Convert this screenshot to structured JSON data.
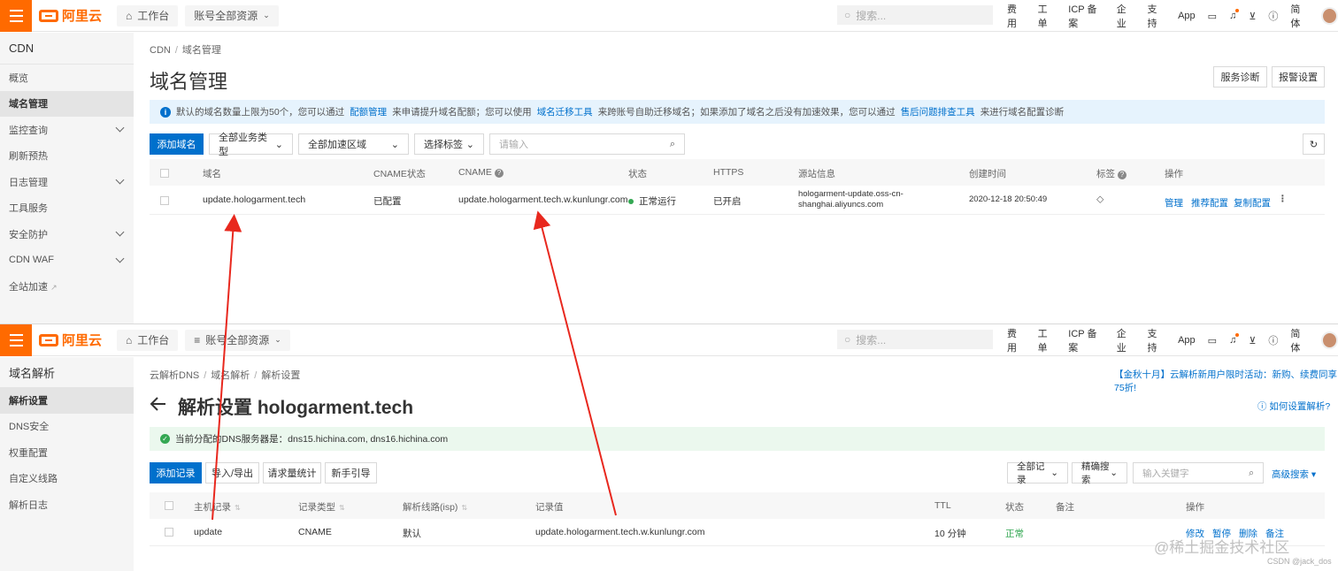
{
  "top": {
    "topbar": {
      "brand": "阿里云",
      "workbench": "工作台",
      "account_resources": "账号全部资源",
      "search_placeholder": "搜索...",
      "right_items": [
        "费用",
        "工单",
        "ICP 备案",
        "企业",
        "支持",
        "App"
      ],
      "lang": "简体"
    },
    "sidebar": {
      "title": "CDN",
      "items": [
        {
          "label": "概览",
          "expand": false,
          "active": false
        },
        {
          "label": "域名管理",
          "expand": false,
          "active": true
        },
        {
          "label": "监控查询",
          "expand": true,
          "active": false
        },
        {
          "label": "刷新预热",
          "expand": false,
          "active": false
        },
        {
          "label": "日志管理",
          "expand": true,
          "active": false
        },
        {
          "label": "工具服务",
          "expand": false,
          "active": false
        },
        {
          "label": "安全防护",
          "expand": true,
          "active": false
        },
        {
          "label": "CDN WAF",
          "expand": true,
          "active": false
        },
        {
          "label": "全站加速",
          "expand": false,
          "active": false,
          "external": true
        }
      ]
    },
    "breadcrumb": [
      "CDN",
      "域名管理"
    ],
    "page_title": "域名管理",
    "header_buttons": {
      "diagnose": "服务诊断",
      "alarm": "报警设置"
    },
    "notice": {
      "t1": "默认的域名数量上限为50个，您可以通过",
      "l1": "配额管理",
      "t2": "来申请提升域名配额；您可以使用",
      "l2": "域名迁移工具",
      "t3": "来跨账号自助迁移域名；如果添加了域名之后没有加速效果，您可以通过",
      "l3": "售后问题排查工具",
      "t4": "来进行域名配置诊断"
    },
    "toolbar": {
      "add_domain": "添加域名",
      "business_type": "全部业务类型",
      "region": "全部加速区域",
      "tags": "选择标签",
      "search_placeholder": "请输入"
    },
    "table": {
      "headers": {
        "domain": "域名",
        "cname_status": "CNAME状态",
        "cname": "CNAME",
        "status": "状态",
        "https": "HTTPS",
        "origin": "源站信息",
        "created": "创建时间",
        "tags": "标签",
        "actions": "操作"
      },
      "rows": [
        {
          "domain": "update.hologarment.tech",
          "cname_status": "已配置",
          "cname": "update.hologarment.tech.w.kunlungr.com",
          "status": "正常运行",
          "https": "已开启",
          "origin_line1": "hologarment-update.oss-cn-",
          "origin_line2": "shanghai.aliyuncs.com",
          "created": "2020-12-18 20:50:49",
          "actions": [
            "管理",
            "推荐配置",
            "复制配置"
          ]
        }
      ]
    }
  },
  "bottom": {
    "topbar": {
      "brand": "阿里云",
      "workbench": "工作台",
      "account_resources": "账号全部资源",
      "search_placeholder": "搜索...",
      "right_items": [
        "费用",
        "工单",
        "ICP 备案",
        "企业",
        "支持",
        "App"
      ],
      "lang": "简体"
    },
    "sidebar": {
      "title": "域名解析",
      "items": [
        {
          "label": "解析设置",
          "active": true
        },
        {
          "label": "DNS安全",
          "active": false
        },
        {
          "label": "权重配置",
          "active": false
        },
        {
          "label": "自定义线路",
          "active": false
        },
        {
          "label": "解析日志",
          "active": false
        }
      ]
    },
    "breadcrumb": [
      "云解析DNS",
      "域名解析",
      "解析设置"
    ],
    "promo": "【金秋十月】云解析新用户限时活动：新购、续费同享75折!",
    "page_title": "解析设置 hologarment.tech",
    "help_link": "如何设置解析?",
    "dns_notice": "当前分配的DNS服务器是：dns15.hichina.com, dns16.hichina.com",
    "toolbar": {
      "add_record": "添加记录",
      "import_export": "导入/导出",
      "request_stats": "请求量统计",
      "guide": "新手引导",
      "all_records": "全部记录",
      "precise_search": "精确搜索",
      "keyword_placeholder": "输入关键字",
      "advanced_search": "高级搜索"
    },
    "table": {
      "headers": {
        "host": "主机记录",
        "type": "记录类型",
        "line": "解析线路(isp)",
        "value": "记录值",
        "ttl": "TTL",
        "status": "状态",
        "remark": "备注",
        "actions": "操作"
      },
      "rows": [
        {
          "host": "update",
          "type": "CNAME",
          "line": "默认",
          "value": "update.hologarment.tech.w.kunlungr.com",
          "ttl": "10 分钟",
          "status": "正常",
          "actions": [
            "修改",
            "暂停",
            "删除",
            "备注"
          ]
        }
      ]
    }
  },
  "watermark": "@稀土掘金技术社区",
  "watermark_small": "CSDN @jack_dos",
  "colors": {
    "brand": "#ff6a00",
    "primary": "#0070cc",
    "success": "#34a853",
    "annotation_arrow": "#e8281e"
  }
}
